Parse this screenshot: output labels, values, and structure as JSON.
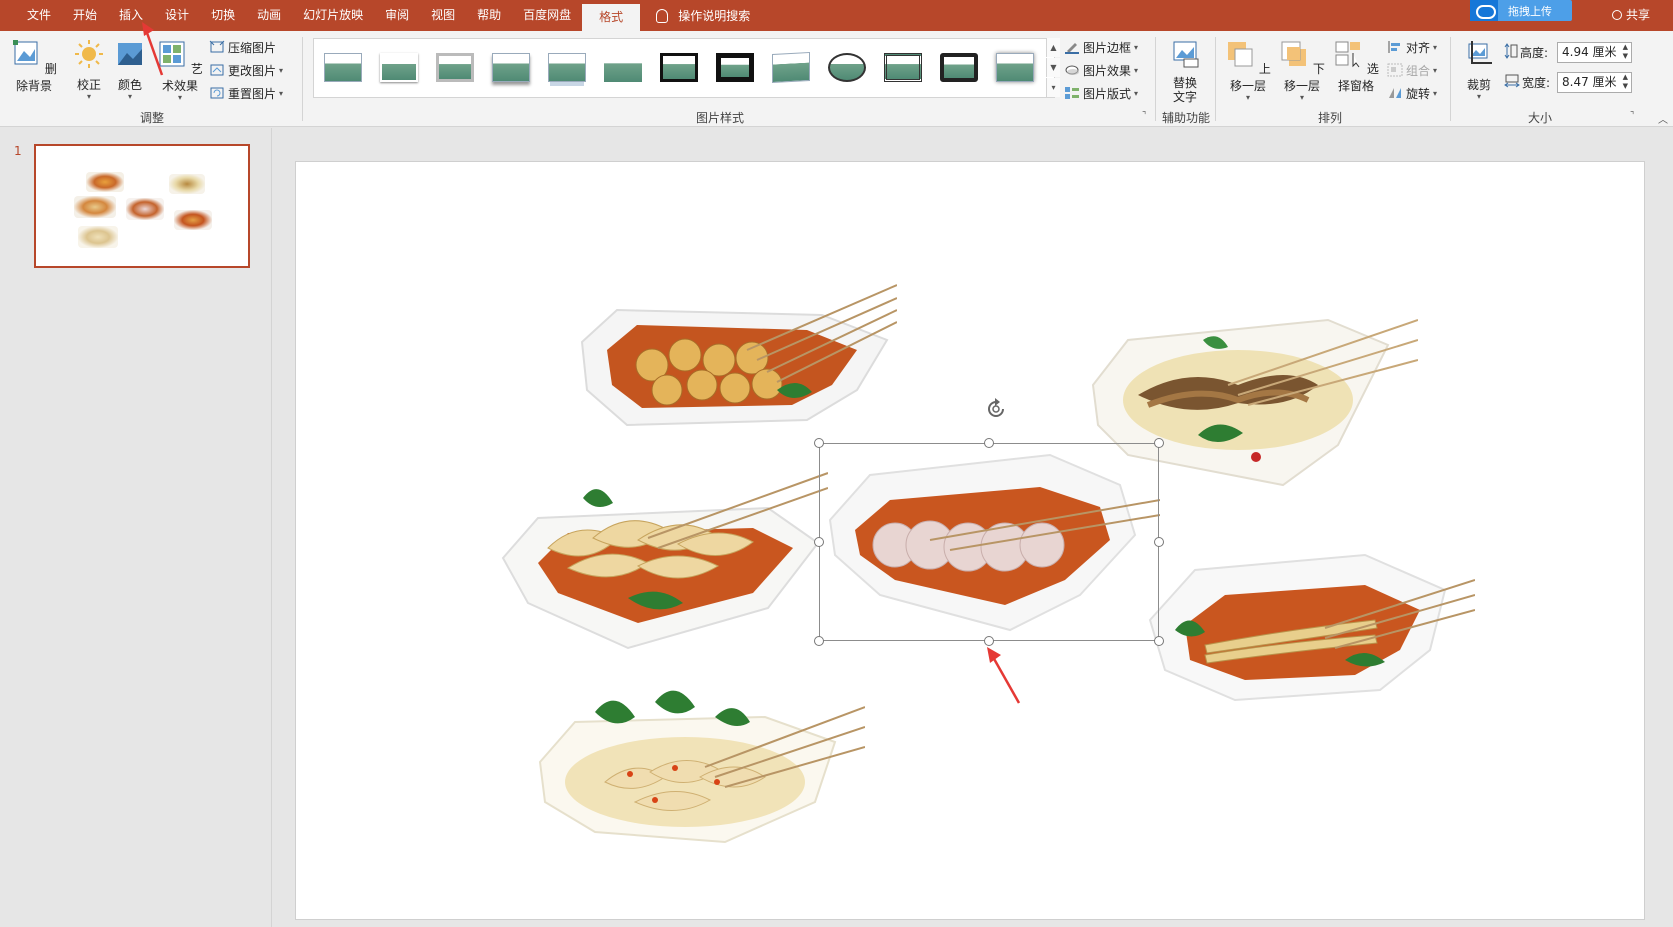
{
  "tabs": [
    {
      "label": "文件"
    },
    {
      "label": "开始"
    },
    {
      "label": "插入"
    },
    {
      "label": "设计"
    },
    {
      "label": "切换"
    },
    {
      "label": "动画"
    },
    {
      "label": "幻灯片放映"
    },
    {
      "label": "审阅"
    },
    {
      "label": "视图"
    },
    {
      "label": "帮助"
    },
    {
      "label": "百度网盘"
    },
    {
      "label": "格式"
    }
  ],
  "active_tab": "格式",
  "tell_me": "操作说明搜索",
  "upload_label": "拖拽上传",
  "share_label": "共享",
  "ribbon": {
    "adjust": {
      "remove_bg": "删除背景",
      "corrections": "校正",
      "color": "颜色",
      "artistic": "艺术效果",
      "compress": "压缩图片",
      "change": "更改图片",
      "reset": "重置图片",
      "group_label": "调整"
    },
    "styles": {
      "group_label": "图片样式",
      "border": "图片边框",
      "effects": "图片效果",
      "layout": "图片版式"
    },
    "accessibility": {
      "alt_text_line1": "替换",
      "alt_text_line2": "文字",
      "group_label": "辅助功能"
    },
    "arrange": {
      "bring_forward": "上移一层",
      "send_backward": "下移一层",
      "selection_pane": "选择窗格",
      "align": "对齐",
      "group": "组合",
      "rotate": "旋转",
      "group_label": "排列"
    },
    "size": {
      "crop": "裁剪",
      "height_label": "高度:",
      "height_value": "4.94 厘米",
      "width_label": "宽度:",
      "width_value": "8.47 厘米",
      "group_label": "大小"
    }
  },
  "slide_pane": {
    "slide_number": "1"
  },
  "colors": {
    "accent": "#b7472a",
    "ribbon_bg": "#f3f3f3",
    "workspace_bg": "#e6e6e6"
  }
}
